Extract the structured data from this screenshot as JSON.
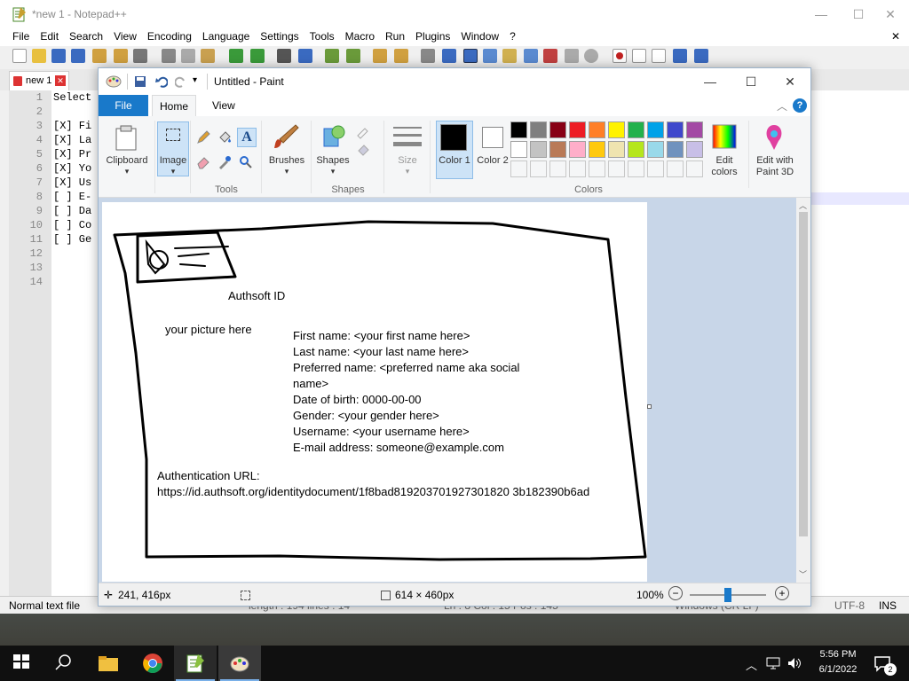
{
  "npp": {
    "title": "*new 1 - Notepad++",
    "menu": [
      "File",
      "Edit",
      "Search",
      "View",
      "Encoding",
      "Language",
      "Settings",
      "Tools",
      "Macro",
      "Run",
      "Plugins",
      "Window",
      "?"
    ],
    "tab_label": "new 1",
    "tab_close": "✕",
    "line_numbers": [
      "1",
      "2",
      "3",
      "4",
      "5",
      "6",
      "7",
      "8",
      "9",
      "10",
      "11",
      "12",
      "13",
      "14"
    ],
    "lines": [
      "Select",
      "",
      "[X] Fi",
      "[X] La",
      "[X] Pr",
      "[X] Yo",
      "[X] Us",
      "[ ] E-",
      "[ ] Da",
      "[ ] Co",
      "[ ] Ge",
      "",
      "",
      ""
    ],
    "status_mode": "Normal text file",
    "status_length": "length : 194    lines : 14",
    "status_pos": "Ln : 8    Col : 15    Pos : 145",
    "status_eol": "Windows (CR LF)",
    "status_enc": "UTF-8",
    "status_ins": "INS"
  },
  "paint": {
    "title": "Untitled - Paint",
    "tabs": {
      "file": "File",
      "home": "Home",
      "view": "View"
    },
    "groups": {
      "tools": "Tools",
      "shapes": "Shapes",
      "colors": "Colors"
    },
    "buttons": {
      "clipboard": "Clipboard",
      "image": "Image",
      "brushes": "Brushes",
      "shapes": "Shapes",
      "size": "Size",
      "color1": "Color 1",
      "color2": "Color 2",
      "edit_colors": "Edit colors",
      "paint3d": "Edit with Paint 3D"
    },
    "palette": [
      "#000000",
      "#7f7f7f",
      "#880015",
      "#ed1c24",
      "#ff7f27",
      "#fff200",
      "#22b14c",
      "#00a2e8",
      "#3f48cc",
      "#a349a4",
      "#ffffff",
      "#c3c3c3",
      "#b97a57",
      "#ffaec9",
      "#ffc90e",
      "#efe4b0",
      "#b5e61d",
      "#99d9ea",
      "#7092be",
      "#c8bfe7"
    ],
    "color1": "#000000",
    "color2": "#ffffff",
    "status_cursor": "241, 416px",
    "status_size": "614 × 460px",
    "status_zoom": "100%"
  },
  "drawing": {
    "header": "Authsoft ID",
    "picture_hint": "your picture here",
    "fields": [
      "First name: <your first name here>",
      "Last name: <your last name here>",
      "Preferred name: <preferred name aka social",
      "name>",
      "Date of birth: 0000-00-00",
      "Gender: <your gender here>",
      "Username: <your username here>",
      "E-mail address: someone@example.com"
    ],
    "auth_label": "Authentication URL:",
    "auth_url": "https://id.authsoft.org/identitydocument/1f8bad819203701927301820 3b182390b6ad"
  },
  "taskbar": {
    "time": "5:56 PM",
    "date": "6/1/2022",
    "notif_count": "2"
  }
}
